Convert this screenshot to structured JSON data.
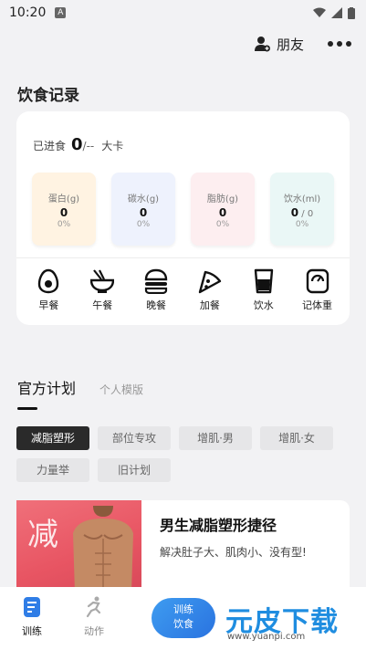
{
  "status_bar": {
    "time": "10:20",
    "notif_letter": "A"
  },
  "header": {
    "friends_label": "朋友"
  },
  "diet": {
    "title": "饮食记录",
    "intake_label": "已进食",
    "intake_value": "0",
    "intake_target": "/--",
    "intake_unit": "大卡",
    "nutrients": [
      {
        "label": "蛋白(g)",
        "value": "0",
        "percent": "0%",
        "color": "#fff3e2"
      },
      {
        "label": "碳水(g)",
        "value": "0",
        "percent": "0%",
        "color": "#eef2fd"
      },
      {
        "label": "脂肪(g)",
        "value": "0",
        "percent": "0%",
        "color": "#fdeef0"
      },
      {
        "label": "饮水(ml)",
        "value": "0",
        "value_sub": " / 0",
        "percent": "0%",
        "color": "#eaf7f6"
      }
    ],
    "meals": [
      {
        "label": "早餐",
        "icon": "egg-icon"
      },
      {
        "label": "午餐",
        "icon": "noodle-bowl-icon"
      },
      {
        "label": "晚餐",
        "icon": "burger-icon"
      },
      {
        "label": "加餐",
        "icon": "pizza-slice-icon"
      },
      {
        "label": "饮水",
        "icon": "water-glass-icon"
      },
      {
        "label": "记体重",
        "icon": "scale-icon"
      }
    ]
  },
  "plans": {
    "tab_official": "官方计划",
    "tab_personal": "个人模版",
    "chips": [
      "减脂塑形",
      "部位专攻",
      "增肌·男",
      "增肌·女",
      "力量举",
      "旧计划"
    ],
    "active_chip": "减脂塑形",
    "card": {
      "image_text": "减",
      "title": "男生减脂塑形捷径",
      "subtitle": "解决肚子大、肌肉小、没有型!"
    }
  },
  "bottom_nav": {
    "train_label": "训练",
    "action_label": "动作",
    "fab_line1": "训练",
    "fab_line2": "饮食"
  },
  "watermark": {
    "text": "元皮下载",
    "url": "www.yuanpi.com"
  }
}
